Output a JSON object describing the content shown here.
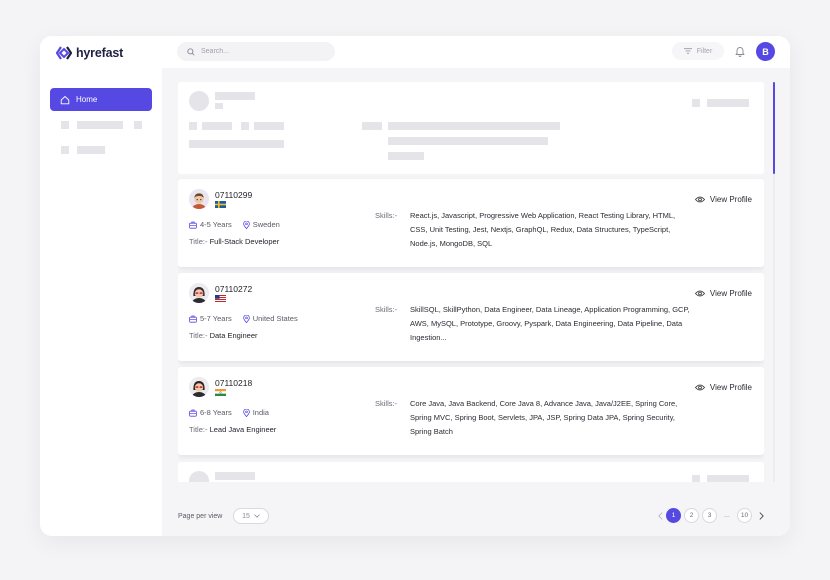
{
  "brand": {
    "name": "hyrefast",
    "accent": "#5648e3"
  },
  "search": {
    "placeholder": "Search..."
  },
  "header": {
    "filter_label": "Filter",
    "avatar_initial": "B"
  },
  "sidebar": {
    "home_label": "Home"
  },
  "candidates": [
    {
      "id": "07110299",
      "flag": "sweden",
      "experience": "4-5 Years",
      "location": "Sweden",
      "title_label": "Title:-",
      "title": "Full-Stack Developer",
      "skills_label": "Skills:-",
      "skills": "React.js, Javascript, Progressive Web Application, React Testing Library, HTML, CSS, Unit Testing, Jest, Nextjs, GraphQL, Redux, Data Structures, TypeScript, Node.js, MongoDB, SQL",
      "view_label": "View Profile"
    },
    {
      "id": "07110272",
      "flag": "united-states",
      "experience": "5-7 Years",
      "location": "United States",
      "title_label": "Title:-",
      "title": "Data Engineer",
      "skills_label": "Skills:-",
      "skills": "SkillSQL, SkillPython, Data Engineer, Data Lineage, Application Programming, GCP, AWS, MySQL, Prototype, Groovy, Pyspark, Data Engineering, Data Pipeline, Data Ingestion...",
      "view_label": "View Profile"
    },
    {
      "id": "07110218",
      "flag": "india",
      "experience": "6-8 Years",
      "location": "India",
      "title_label": "Title:-",
      "title": "Lead Java Engineer",
      "skills_label": "Skills:-",
      "skills": "Core Java, Java Backend, Core Java 8, Advance Java, Java/J2EE, Spring Core, Spring MVC, Spring Boot, Servlets, JPA, JSP, Spring Data JPA, Spring Security, Spring Batch",
      "view_label": "View Profile"
    }
  ],
  "footer": {
    "per_page_label": "Page per view",
    "per_page_value": "15",
    "pages": [
      "1",
      "2",
      "3"
    ],
    "ellipsis": "...",
    "last_page": "10",
    "current_page": 1
  }
}
